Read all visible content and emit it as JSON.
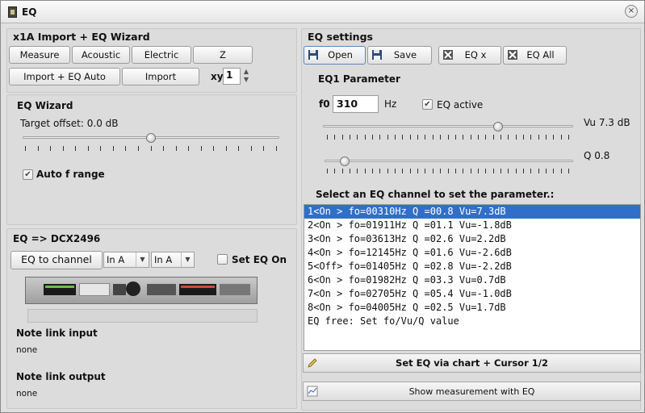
{
  "window": {
    "title": "EQ",
    "close_glyph": "×"
  },
  "import_panel": {
    "title": "x1A Import + EQ Wizard",
    "buttons": {
      "measure": "Measure",
      "acoustic": "Acoustic",
      "electric": "Electric",
      "z": "Z",
      "import_auto": "Import + EQ Auto",
      "import": "Import"
    },
    "xy_label": "xy",
    "xy_value": "1"
  },
  "wizard": {
    "title": "EQ Wizard",
    "target_offset": "Target offset: 0.0 dB",
    "target_offset_fraction": 0.5,
    "auto_range_label": "Auto f range",
    "auto_range_checked": true
  },
  "dcx": {
    "title": "EQ => DCX2496",
    "to_channel_label": "EQ to channel",
    "combo1": "In A",
    "combo2": "In A",
    "set_eq_on_label": "Set EQ On",
    "note_input_label": "Note link input",
    "note_input_value": "none",
    "note_output_label": "Note link output",
    "note_output_value": "none"
  },
  "settings": {
    "title": "EQ settings",
    "buttons": {
      "open": "Open",
      "save": "Save",
      "eq_x": "EQ x",
      "eq_all": "EQ All"
    },
    "param_title": "EQ1 Parameter",
    "f0_label": "f0",
    "f0_value": "310",
    "hz_label": "Hz",
    "eq_active_label": "EQ active",
    "eq_active_checked": true,
    "vu_label": "Vu 7.3 dB",
    "vu_fraction": 0.7,
    "q_label": "Q 0.8",
    "q_fraction": 0.08,
    "select_hint": "Select an EQ channel to set the parameter.:",
    "channels": [
      "1<On > fo=00310Hz Q =00.8 Vu=7.3dB",
      "2<On > fo=01911Hz Q =01.1 Vu=-1.8dB",
      "3<On > fo=03613Hz Q =02.6 Vu=2.2dB",
      "4<On > fo=12145Hz Q =01.6 Vu=-2.6dB",
      "5<Off> fo=01405Hz Q =02.8 Vu=-2.2dB",
      "6<On > fo=01982Hz Q =03.3 Vu=0.7dB",
      "7<On > fo=02705Hz Q =05.4 Vu=-1.0dB",
      "8<On > fo=04005Hz Q =02.5 Vu=1.7dB",
      "EQ free: Set fo/Vu/Q value"
    ],
    "selected_index": 0,
    "set_eq_chart": "Set EQ via chart + Cursor 1/2",
    "show_measurement": "Show measurement with EQ"
  }
}
